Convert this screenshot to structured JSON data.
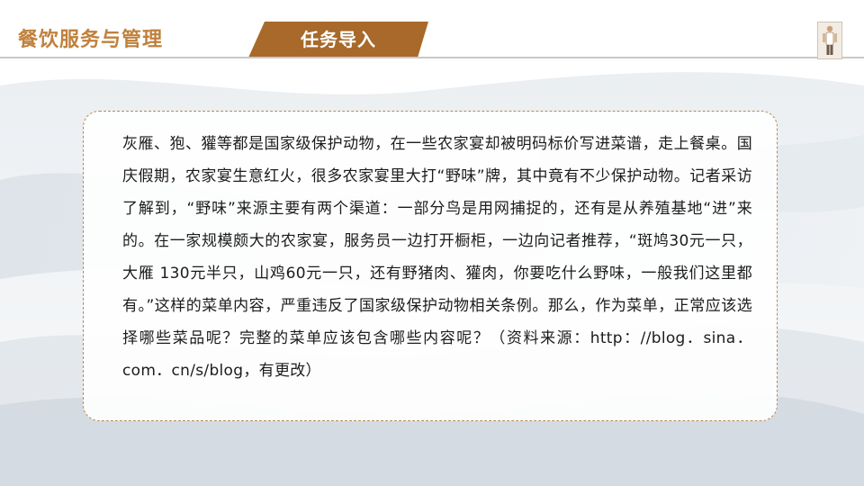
{
  "header": {
    "course_title": "餐饮服务与管理",
    "tab_label": "任务导入",
    "tab_color": "#a8692a",
    "title_color": "#c0813d"
  },
  "thumbnail": {
    "icon": "chef-figure-icon"
  },
  "content": {
    "paragraph": "灰雁、狍、獾等都是国家级保护动物，在一些农家宴却被明码标价写进菜谱，走上餐桌。国庆假期，农家宴生意红火，很多农家宴里大打“野味”牌，其中竟有不少保护动物。记者采访了解到，“野味”来源主要有两个渠道：一部分鸟是用网捕捉的，还有是从养殖基地“进”来的。在一家规模颇大的农家宴，服务员一边打开橱柜，一边向记者推荐，“斑鸠30元一只，大雁 130元半只，山鸡60元一只，还有野猪肉、獾肉，你要吃什么野味，一般我们这里都有。”这样的菜单内容，严重违反了国家级保护动物相关条例。那么，作为菜单，正常应该选择哪些菜品呢？完整的菜单应该包含哪些内容呢？（资料来源：http：//blog．sina．com．cn/s/blog，有更改）"
  }
}
